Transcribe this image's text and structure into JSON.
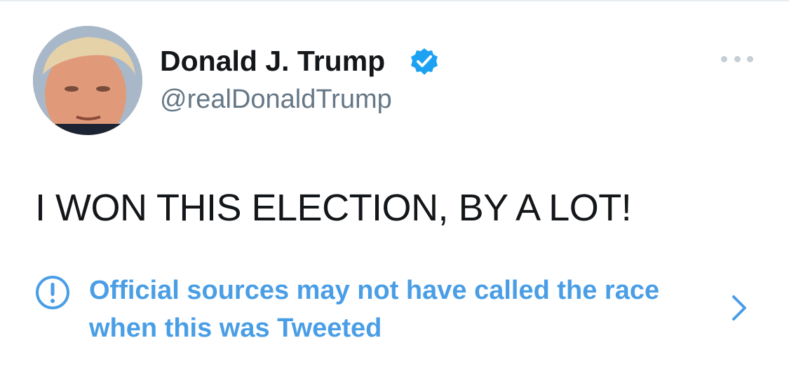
{
  "tweet": {
    "author": {
      "display_name": "Donald J. Trump",
      "handle": "@realDonaldTrump",
      "verified": true,
      "avatar_icon": "profile-photo"
    },
    "text": "I WON THIS ELECTION, BY A LOT!",
    "more_icon": "ellipsis-icon",
    "notice": {
      "icon": "exclamation-circle-icon",
      "text": "Official sources may not have called the race when this was Tweeted",
      "chevron_icon": "chevron-right-icon"
    }
  },
  "colors": {
    "text_primary": "#14171a",
    "text_secondary": "#657786",
    "accent": "#4a9ee6",
    "verified_badge": "#1da1f2"
  }
}
